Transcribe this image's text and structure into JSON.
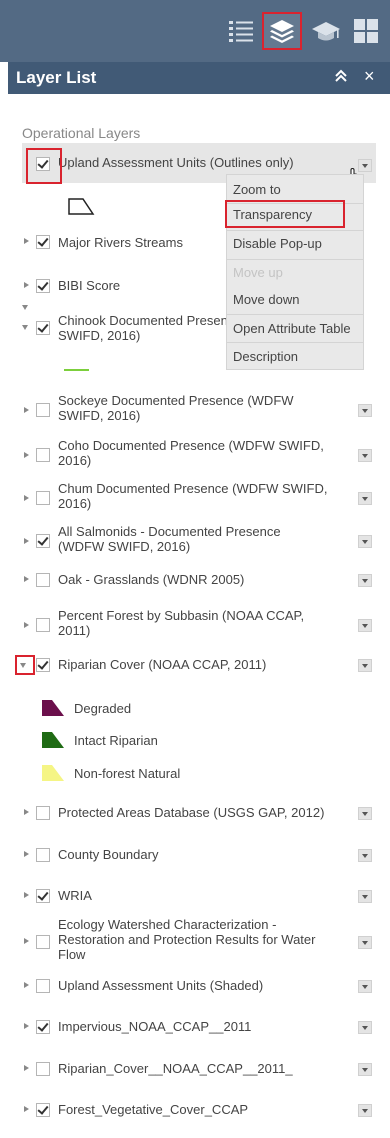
{
  "toolbar": {
    "icons": [
      "legend-list-icon",
      "layers-icon",
      "graduation-cap-icon",
      "grid-icon"
    ],
    "active": "layers-icon",
    "background": "#536a84",
    "annotation_color": "#d9232e"
  },
  "panel": {
    "title": "Layer List",
    "collapse_glyph": "≈",
    "close_glyph": "×",
    "header_color": "#415a76"
  },
  "section": {
    "title": "Operational Layers"
  },
  "layers": [
    {
      "label": "Upland Assessment Units (Outlines only)",
      "checked": true,
      "expanded": true
    },
    {
      "label": "Major Rivers Streams",
      "checked": true,
      "expanded": false
    },
    {
      "label": "BIBI Score",
      "checked": true,
      "expanded": false
    },
    {
      "label": "Chinook Documented Presence (WDFW",
      "label2": "SWIFD, 2016)",
      "checked": true,
      "expanded": true
    },
    {
      "label": "Sockeye Documented Presence (WDFW",
      "label2": "SWIFD, 2016)",
      "checked": false,
      "expanded": false
    },
    {
      "label": "Coho Documented Presence (WDFW SWIFD,",
      "label2": "2016)",
      "checked": false,
      "expanded": false
    },
    {
      "label": "Chum Documented Presence (WDFW SWIFD,",
      "label2": "2016)",
      "checked": false,
      "expanded": false
    },
    {
      "label": "All Salmonids - Documented Presence",
      "label2": "(WDFW SWIFD, 2016)",
      "checked": true,
      "expanded": false
    },
    {
      "label": "Oak - Grasslands (WDNR 2005)",
      "checked": false,
      "expanded": false
    },
    {
      "label": "Percent Forest by Subbasin (NOAA CCAP,",
      "label2": "2011)",
      "checked": false,
      "expanded": false
    },
    {
      "label": "Riparian Cover (NOAA CCAP, 2011)",
      "checked": true,
      "expanded": true
    },
    {
      "label": "Protected Areas Database (USGS GAP, 2012)",
      "checked": false,
      "expanded": false
    },
    {
      "label": "County Boundary",
      "checked": false,
      "expanded": false
    },
    {
      "label": "WRIA",
      "checked": true,
      "expanded": false
    },
    {
      "label": "Ecology Watershed Characterization -",
      "label2": "Restoration and Protection Results for Water",
      "label3": "Flow",
      "checked": false,
      "expanded": false
    },
    {
      "label": "Upland Assessment Units (Shaded)",
      "checked": false,
      "expanded": false
    },
    {
      "label": "Impervious_NOAA_CCAP__2011",
      "checked": true,
      "expanded": false
    },
    {
      "label": "Riparian_Cover__NOAA_CCAP__2011_",
      "checked": false,
      "expanded": false
    },
    {
      "label": "Forest_Vegetative_Cover_CCAP",
      "checked": true,
      "expanded": false
    }
  ],
  "legend": {
    "riparian": [
      {
        "label": "Degraded",
        "color": "#6b0f4b"
      },
      {
        "label": "Intact Riparian",
        "color": "#1f6b14"
      },
      {
        "label": "Non-forest Natural",
        "color": "#f5f585"
      }
    ],
    "chinook_line_color": "#7ccf3c"
  },
  "menu": {
    "items": [
      {
        "label": "Zoom to",
        "disabled": false
      },
      {
        "label": "Transparency",
        "disabled": false,
        "highlighted": true
      },
      {
        "label": "Disable Pop-up",
        "disabled": false
      },
      {
        "label": "Move up",
        "disabled": true
      },
      {
        "label": "Move down",
        "disabled": false
      },
      {
        "label": "Open Attribute Table",
        "disabled": false
      },
      {
        "label": "Description",
        "disabled": false
      }
    ]
  }
}
